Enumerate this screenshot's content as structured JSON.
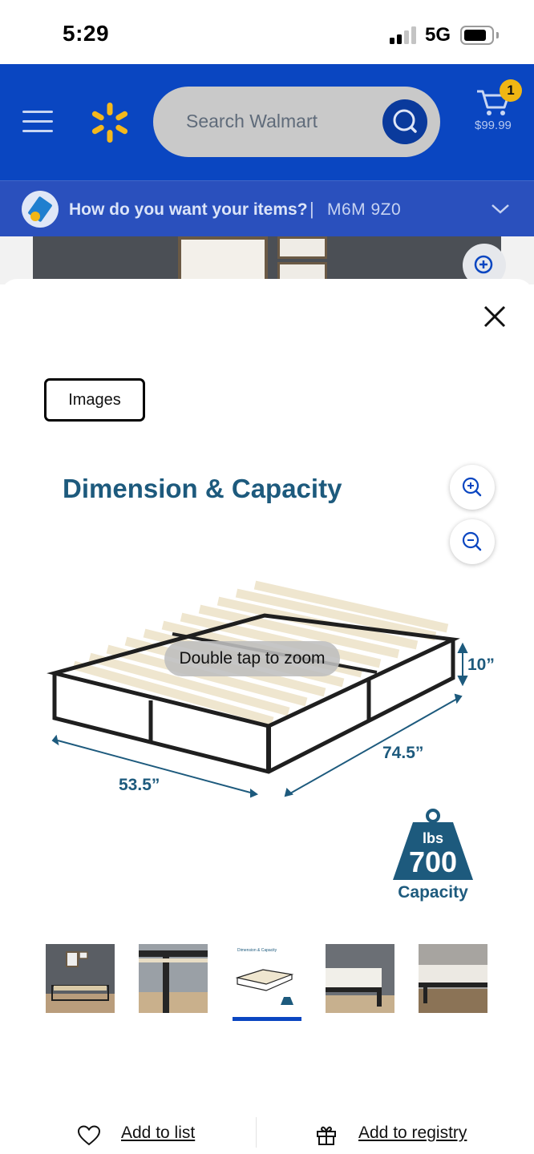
{
  "status_bar": {
    "time": "5:29",
    "network": "5G",
    "icons": [
      "signal-icon",
      "battery-icon"
    ]
  },
  "header": {
    "menu_icon": "menu-icon",
    "logo_icon": "walmart-spark-icon",
    "search": {
      "placeholder": "Search Walmart",
      "icon": "search-icon"
    },
    "cart": {
      "count": "1",
      "total": "$99.99",
      "icon": "cart-icon"
    },
    "colors": {
      "header_bg": "#0a46c1",
      "spark": "#f4b81c",
      "badge": "#f0b614"
    }
  },
  "delivery": {
    "question": "How do you want your items?",
    "separator": "|",
    "postal_code": "M6M 9Z0",
    "chevron_icon": "chevron-down-icon"
  },
  "modal": {
    "close_icon": "close-icon",
    "tab_label": "Images",
    "image": {
      "title": "Dimension & Capacity",
      "height_label": "10”",
      "length_label": "74.5”",
      "width_label": "53.5”",
      "weight_unit": "lbs",
      "weight_value": "700",
      "weight_caption": "Capacity"
    },
    "zoom_in_icon": "zoom-in-icon",
    "zoom_out_icon": "zoom-out-icon",
    "hint": "Double tap to zoom",
    "thumbnails": [
      {
        "name": "bed-frame-in-room",
        "selected": false
      },
      {
        "name": "bed-frame-closeup",
        "selected": false
      },
      {
        "name": "dimension-capacity",
        "selected": true,
        "title": "Dimension & Capacity"
      },
      {
        "name": "bed-with-mattress",
        "selected": false
      },
      {
        "name": "bed-side-view",
        "selected": false
      }
    ]
  },
  "actions": {
    "add_to_list": "Add to list",
    "add_to_registry": "Add to registry",
    "heart_icon": "heart-icon",
    "gift_icon": "gift-icon"
  }
}
